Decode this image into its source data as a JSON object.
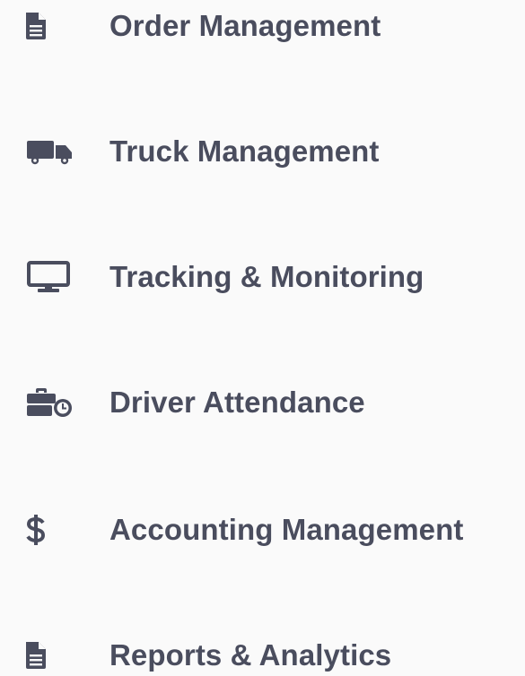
{
  "menu": {
    "items": [
      {
        "label": "Order Management",
        "icon": "document-icon"
      },
      {
        "label": "Truck Management",
        "icon": "truck-icon"
      },
      {
        "label": "Tracking & Monitoring",
        "icon": "monitor-icon"
      },
      {
        "label": "Driver Attendance",
        "icon": "briefcase-clock-icon"
      },
      {
        "label": "Accounting Management",
        "icon": "dollar-icon"
      },
      {
        "label": "Reports & Analytics",
        "icon": "document-icon"
      }
    ]
  },
  "colors": {
    "background": "#fafafa",
    "text": "#4a4d5e",
    "icon": "#4a4d5e"
  }
}
